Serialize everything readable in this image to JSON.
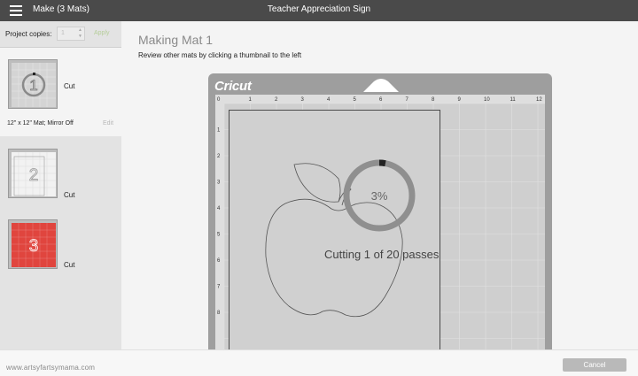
{
  "topbar": {
    "app_title": "Make (3 Mats)",
    "document_title": "Teacher Appreciation Sign",
    "menu_icon": "hamburger-menu-icon"
  },
  "sidebar": {
    "copies_label": "Project copies:",
    "copies_value": "1",
    "apply_label": "Apply",
    "mats": [
      {
        "number": "1",
        "action": "Cut",
        "info": "12\" x 12\" Mat; Mirror Off",
        "edit_label": "Edit",
        "selected": true
      },
      {
        "number": "2",
        "action": "Cut"
      },
      {
        "number": "3",
        "action": "Cut"
      }
    ]
  },
  "main": {
    "title": "Making Mat 1",
    "subtitle": "Review other mats by clicking a thumbnail to the left",
    "brand": "Cricut",
    "ruler_top": [
      "0",
      "1",
      "2",
      "3",
      "4",
      "5",
      "6",
      "7",
      "8",
      "9",
      "10",
      "11",
      "12"
    ],
    "ruler_left": [
      "1",
      "2",
      "3",
      "4",
      "5",
      "6",
      "7",
      "8"
    ],
    "progress_label": "3%",
    "progress_fraction": 0.03,
    "passes_label": "Cutting 1 of 20 passes"
  },
  "footer": {
    "watermark": "www.artsyfartsymama.com",
    "cancel_label": "Cancel"
  },
  "colors": {
    "topbar": "#4a4a4a",
    "mat": "#9e9e9e",
    "mat3_red": "#e0453e",
    "apply_green": "#b6ce9a"
  }
}
